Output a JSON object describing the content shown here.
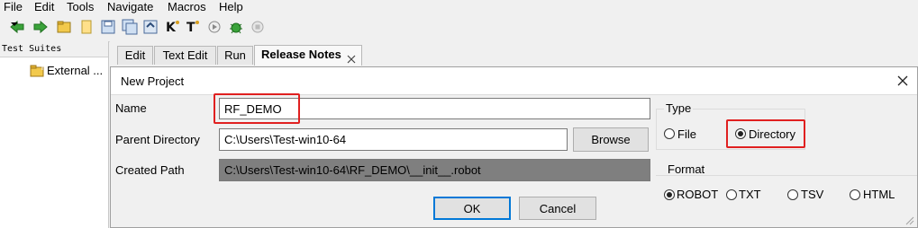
{
  "menu": [
    "File",
    "Edit",
    "Tools",
    "Navigate",
    "Macros",
    "Help"
  ],
  "toolbar_icons": [
    "back-arrow-icon",
    "forward-arrow-icon",
    "open-folder-icon",
    "new-file-icon",
    "save-icon",
    "save-all-icon",
    "open-icon",
    "keyword-search-icon",
    "text-search-icon",
    "run-icon",
    "debug-bug-icon",
    "stop-icon"
  ],
  "tree": {
    "header": "Test Suites",
    "items": [
      "External ..."
    ]
  },
  "tabs": [
    {
      "label": "Edit"
    },
    {
      "label": "Text Edit"
    },
    {
      "label": "Run"
    },
    {
      "label": "Release Notes"
    }
  ],
  "dialog": {
    "title": "New Project",
    "name_label": "Name",
    "name_value": "RF_DEMO",
    "parent_label": "Parent Directory",
    "parent_value": "C:\\Users\\Test-win10-64",
    "browse_label": "Browse",
    "created_label": "Created Path",
    "created_value": "C:\\Users\\Test-win10-64\\RF_DEMO\\__init__.robot",
    "type_label": "Type",
    "type_options": [
      "File",
      "Directory"
    ],
    "type_selected": "Directory",
    "format_label": "Format",
    "format_options": [
      "ROBOT",
      "TXT",
      "TSV",
      "HTML"
    ],
    "format_selected": "ROBOT",
    "ok_label": "OK",
    "cancel_label": "Cancel"
  },
  "colors": {
    "highlight": "#e02020",
    "created_path_bg": "#7f7f7f",
    "ok_border": "#0078d7"
  }
}
